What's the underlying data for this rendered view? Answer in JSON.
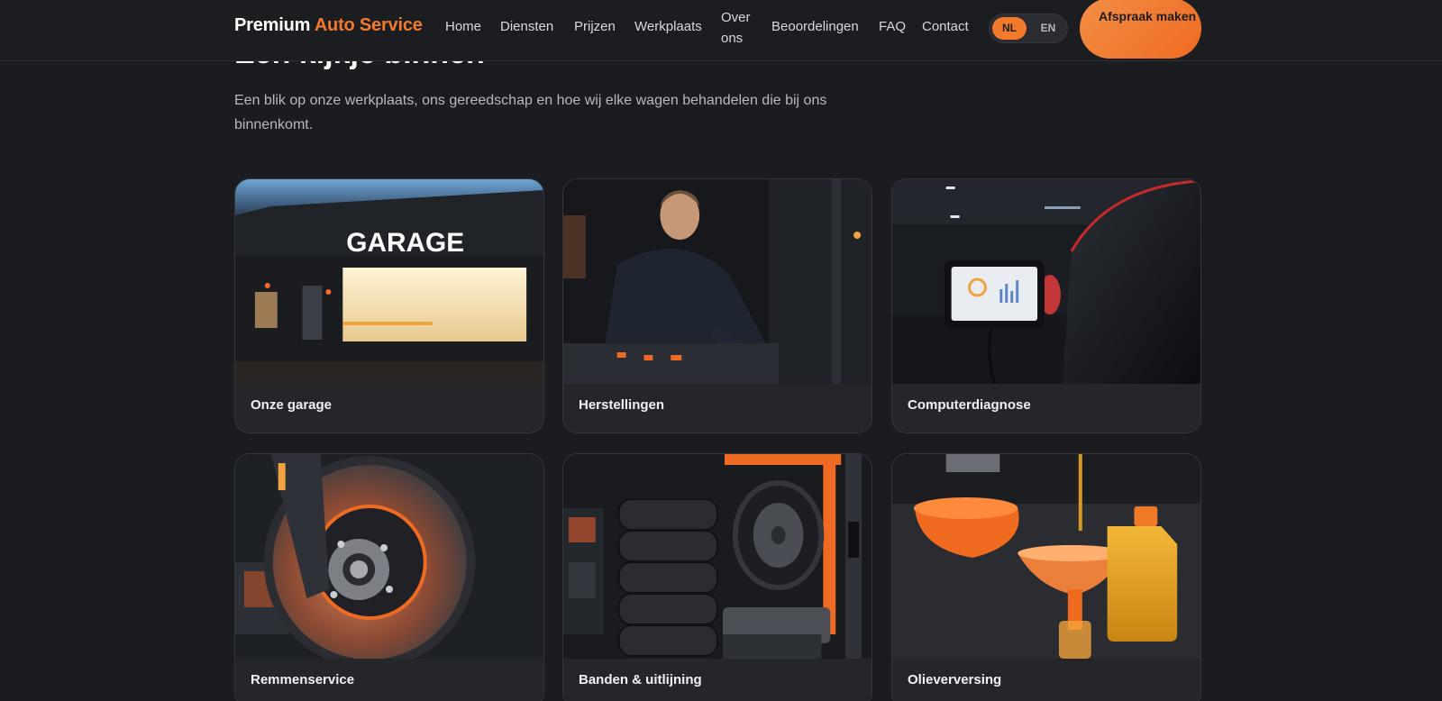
{
  "header": {
    "brand_part1": "Premium",
    "brand_part2": "Auto Service",
    "nav": [
      {
        "label": "Home"
      },
      {
        "label": "Diensten"
      },
      {
        "label": "Prijzen"
      },
      {
        "label": "Werkplaats"
      },
      {
        "label": "Over ons"
      },
      {
        "label": "Beoordelingen"
      },
      {
        "label": "FAQ"
      },
      {
        "label": "Contact"
      }
    ],
    "language": {
      "options": [
        "NL",
        "EN"
      ],
      "active": "NL"
    },
    "cta_label": "Afspraak maken"
  },
  "section": {
    "title": "Een kijkje binnen",
    "subtitle": "Een blik op onze werkplaats, ons gereedschap en hoe wij elke wagen behandelen die bij ons binnenkomt."
  },
  "gallery": [
    {
      "caption": "Onze garage",
      "image": "garage-exterior-photo",
      "sign_text": "GARAGE"
    },
    {
      "caption": "Herstellingen",
      "image": "mechanic-repair-photo"
    },
    {
      "caption": "Computerdiagnose",
      "image": "diagnostic-tablet-photo"
    },
    {
      "caption": "Remmenservice",
      "image": "brake-disc-photo"
    },
    {
      "caption": "Banden & uitlijning",
      "image": "tire-stack-photo"
    },
    {
      "caption": "Olieverversing",
      "image": "oil-change-photo"
    }
  ],
  "colors": {
    "accent": "#f37a2a",
    "background": "#1b1c1f",
    "card": "#24262a"
  }
}
